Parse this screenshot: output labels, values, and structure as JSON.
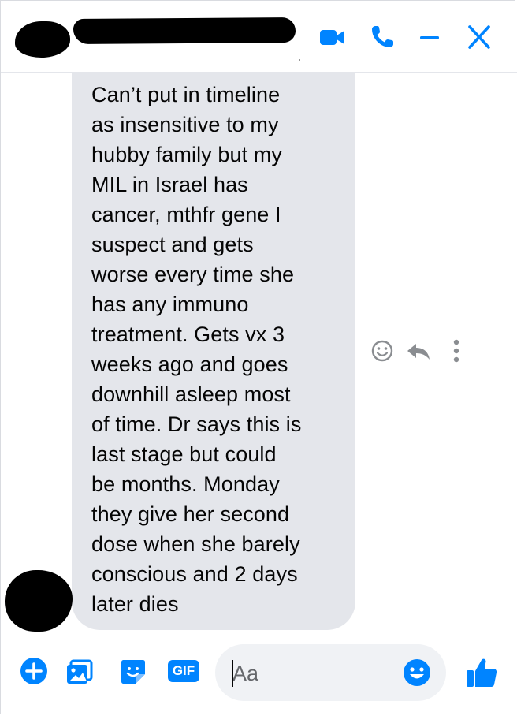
{
  "header": {
    "contact_name": "",
    "icons": [
      "video-camera-icon",
      "phone-icon",
      "minimize-icon",
      "close-icon"
    ],
    "accent_color": "#0084ff"
  },
  "message": {
    "text": "Can’t put in timeline\nas insensitive to my\nhubby family but my\nMIL in Israel has\ncancer, mthfr gene I\nsuspect and gets\nworse every time she\nhas any immuno\ntreatment. Gets vx 3\nweeks ago and goes\ndownhill asleep most\nof time. Dr says this is\nlast stage but could\nbe months. Monday\nthey give her second\ndose when she barely\nconscious and 2 days\nlater dies",
    "bubble_color": "#e4e6eb",
    "actions": [
      "react-icon",
      "reply-icon",
      "more-icon"
    ]
  },
  "composer": {
    "placeholder": "Aa",
    "gif_label": "GIF",
    "icons": [
      "plus-icon",
      "photo-icon",
      "sticker-icon",
      "gif-icon",
      "emoji-icon",
      "thumbs-up-icon"
    ]
  }
}
